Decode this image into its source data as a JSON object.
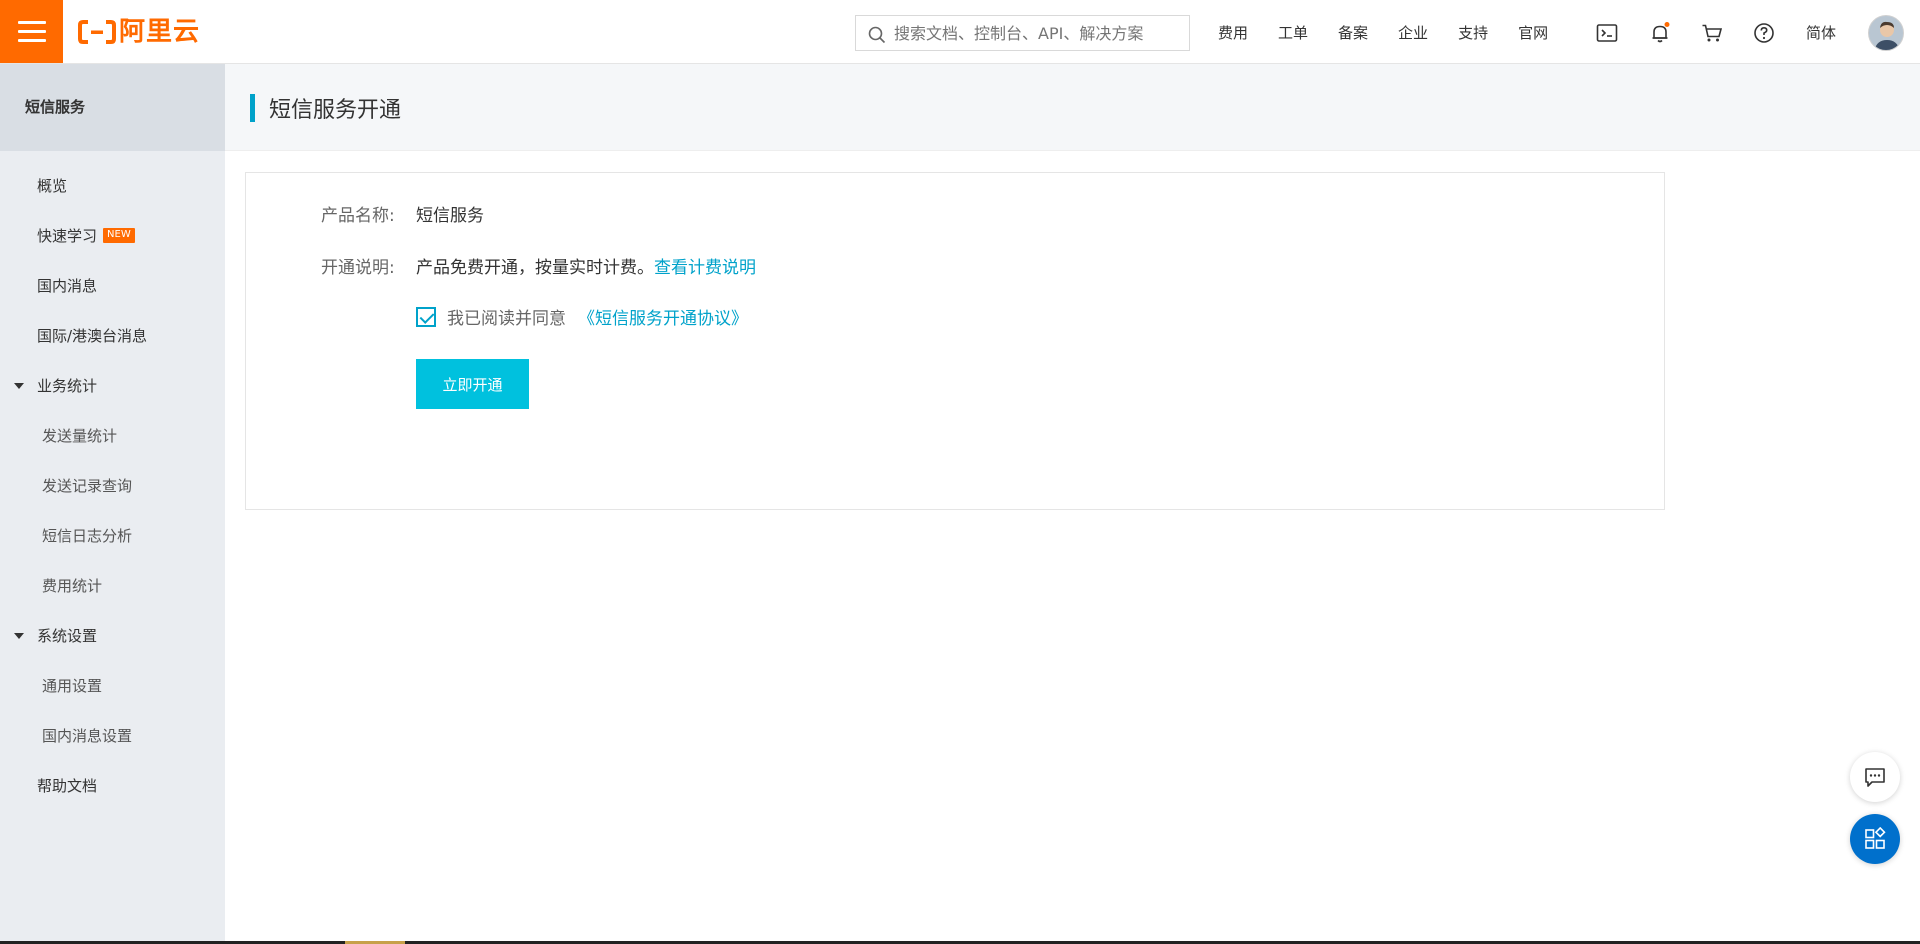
{
  "brand": {
    "logo_text": "阿里云",
    "accent": "#ff6a00"
  },
  "search": {
    "placeholder": "搜索文档、控制台、API、解决方案"
  },
  "top_nav": {
    "items": [
      "费用",
      "工单",
      "备案",
      "企业",
      "支持",
      "官网"
    ],
    "icons": [
      "terminal-icon",
      "bell-icon",
      "cart-icon",
      "help-icon"
    ],
    "language": "简体"
  },
  "sidebar": {
    "title": "短信服务",
    "items": [
      {
        "label": "概览",
        "type": "item"
      },
      {
        "label": "快速学习",
        "type": "item",
        "badge": "NEW"
      },
      {
        "label": "国内消息",
        "type": "item"
      },
      {
        "label": "国际/港澳台消息",
        "type": "item"
      },
      {
        "label": "业务统计",
        "type": "group"
      },
      {
        "label": "发送量统计",
        "type": "sub"
      },
      {
        "label": "发送记录查询",
        "type": "sub"
      },
      {
        "label": "短信日志分析",
        "type": "sub"
      },
      {
        "label": "费用统计",
        "type": "sub"
      },
      {
        "label": "系统设置",
        "type": "group"
      },
      {
        "label": "通用设置",
        "type": "sub"
      },
      {
        "label": "国内消息设置",
        "type": "sub"
      },
      {
        "label": "帮助文档",
        "type": "item"
      }
    ]
  },
  "page": {
    "title": "短信服务开通",
    "product_label": "产品名称:",
    "product_value": "短信服务",
    "desc_label": "开通说明:",
    "desc_value": "产品免费开通，按量实时计费。",
    "desc_link": "查看计费说明",
    "agree_text": "我已阅读并同意",
    "agree_link": "《短信服务开通协议》",
    "agree_checked": true,
    "open_button": "立即开通"
  },
  "colors": {
    "link": "#00a2ca",
    "primary_button": "#00c1de",
    "float_button": "#0070cc"
  }
}
